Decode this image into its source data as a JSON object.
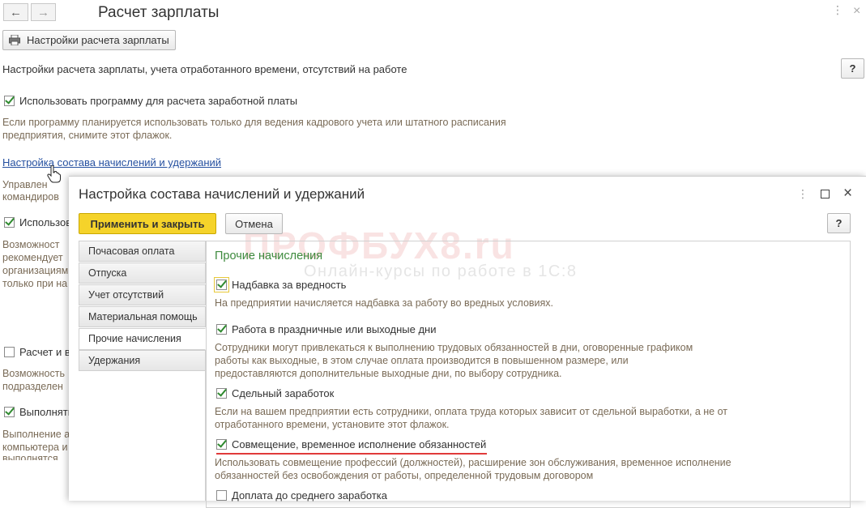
{
  "window": {
    "title": "Расчет зарплаты",
    "back_icon": "←",
    "forward_icon": "→",
    "settings_button": "Настройки расчета зарплаты",
    "section_header": "Настройки расчета зарплаты, учета отработанного времени, отсутствий на работе",
    "help": "?",
    "use_program_label": "Использовать программу для расчета заработной платы",
    "use_program_hint_1": "Если программу планируется использовать только для ведения кадрового учета или штатного расписания",
    "use_program_hint_2": "предприятия, снимите этот флажок.",
    "link": "Настройка состава начислений и удержаний",
    "partial": {
      "hint1a": "Управлен",
      "hint1b": "командиров",
      "cb2": "Использов",
      "hint2a": "Возможност",
      "hint2b": "рекомендует",
      "hint2c": "организациям",
      "hint2d": "только при на",
      "cb3": "Расчет и в",
      "hint3a": "Возможность",
      "hint3b": "подразделен",
      "cb4": "Выполнять",
      "hint4a": "Выполнение а",
      "hint4b": "компьютера и",
      "hint4c": "выполнятся"
    }
  },
  "modal": {
    "title": "Настройка состава начислений и удержаний",
    "apply_button": "Применить и закрыть",
    "cancel_button": "Отмена",
    "help": "?",
    "tabs": [
      {
        "label": "Почасовая оплата"
      },
      {
        "label": "Отпуска"
      },
      {
        "label": "Учет отсутствий"
      },
      {
        "label": "Материальная помощь"
      },
      {
        "label": "Прочие начисления"
      },
      {
        "label": "Удержания"
      }
    ],
    "section_title": "Прочие начисления",
    "items": [
      {
        "label": "Надбавка за вредность",
        "checked": true,
        "hint": [
          "На предприятии начисляется надбавка за работу во вредных условиях."
        ]
      },
      {
        "label": "Работа в праздничные или выходные дни",
        "checked": true,
        "hint": [
          "Сотрудники могут привлекаться к выполнению трудовых обязанностей в дни, оговоренные графиком",
          "работы как выходные, в этом случае оплата производится в повышенном размере, или",
          "предоставляются дополнительные выходные дни, по выбору сотрудника."
        ]
      },
      {
        "label": "Сдельный заработок",
        "checked": true,
        "hint": [
          "Если на вашем предприятии есть сотрудники, оплата труда которых зависит от сдельной выработки, а не от",
          "отработанного времени, установите этот флажок."
        ]
      },
      {
        "label": "Совмещение, временное исполнение обязанностей",
        "checked": true,
        "hint": [
          "Использовать совмещение профессий (должностей), расширение зон обслуживания, временное исполнение",
          "обязанностей без освобождения от работы, определенной трудовым договором"
        ]
      },
      {
        "label": "Доплата до среднего заработка",
        "checked": false,
        "hint": []
      }
    ]
  },
  "watermark": {
    "brand": "ПРОФБУХ8.ru",
    "tagline": "Онлайн-курсы по работе в 1С:8"
  },
  "colors": {
    "apply_yellow": "#f5d32a",
    "section_green": "#3d8a3d",
    "link_blue": "#2550a0",
    "hint_brown": "#7a6b57",
    "annotation_red": "#e03a3a"
  }
}
